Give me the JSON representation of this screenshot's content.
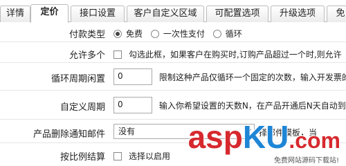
{
  "tabs": [
    {
      "label": "详情",
      "active": false
    },
    {
      "label": "定价",
      "active": true
    },
    {
      "label": "接口设置",
      "active": false
    },
    {
      "label": "客户自定义区域",
      "active": false
    },
    {
      "label": "可配置选项",
      "active": false
    },
    {
      "label": "升级选项",
      "active": false
    },
    {
      "label": "免",
      "active": false
    }
  ],
  "payment_type": {
    "label": "付款类型",
    "options": [
      {
        "label": "免费",
        "checked": true
      },
      {
        "label": "一次性支付",
        "checked": false
      },
      {
        "label": "循环",
        "checked": false
      }
    ]
  },
  "allow_multiple": {
    "label": "允许多个",
    "checked": false,
    "text": "勾选此框，如果客户在购买时,订购产品超过一个时,则允许"
  },
  "recurring_cycle_limit": {
    "label": "循环周期闲置",
    "value": "0",
    "hint": "限制这种产品仅循环一个固定的次数，输入开发票的"
  },
  "custom_cycle": {
    "label": "自定义周期",
    "value": "0",
    "hint": "输入你希望设置的天数N，在产品开通后N天自动到"
  },
  "delete_notify_email": {
    "label": "产品删除通知邮件",
    "selected": "没有",
    "hint": "择邮件模板，当"
  },
  "prorata": {
    "label": "按比例结算",
    "checked": false,
    "text": "选择以启用"
  },
  "watermark": {
    "brand_asp": "asp",
    "brand_k": "K",
    "brand_u": "U",
    "brand_cn": ".com",
    "sub": "免费网站源码下载站!"
  }
}
